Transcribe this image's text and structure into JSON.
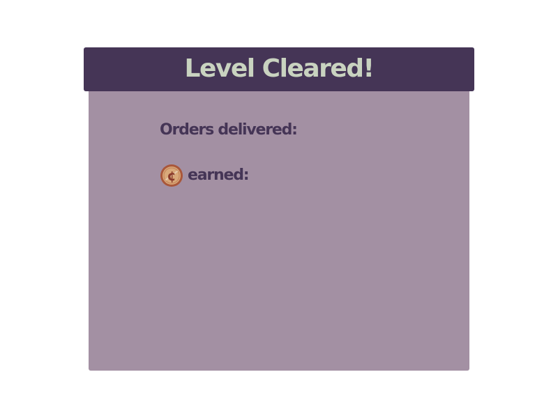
{
  "level_result": {
    "title": "Level Cleared!",
    "orders_label": "Orders delivered:",
    "earned_label": "earned:",
    "coin_symbol": "¢"
  },
  "colors": {
    "header_bg": "#453556",
    "header_text": "#c9d3c0",
    "panel_bg": "#a390a3",
    "label_text": "#453556",
    "coin_fill": "#d9a97a",
    "coin_rim": "#a9573a"
  },
  "icons": {
    "currency": "coin-icon"
  }
}
